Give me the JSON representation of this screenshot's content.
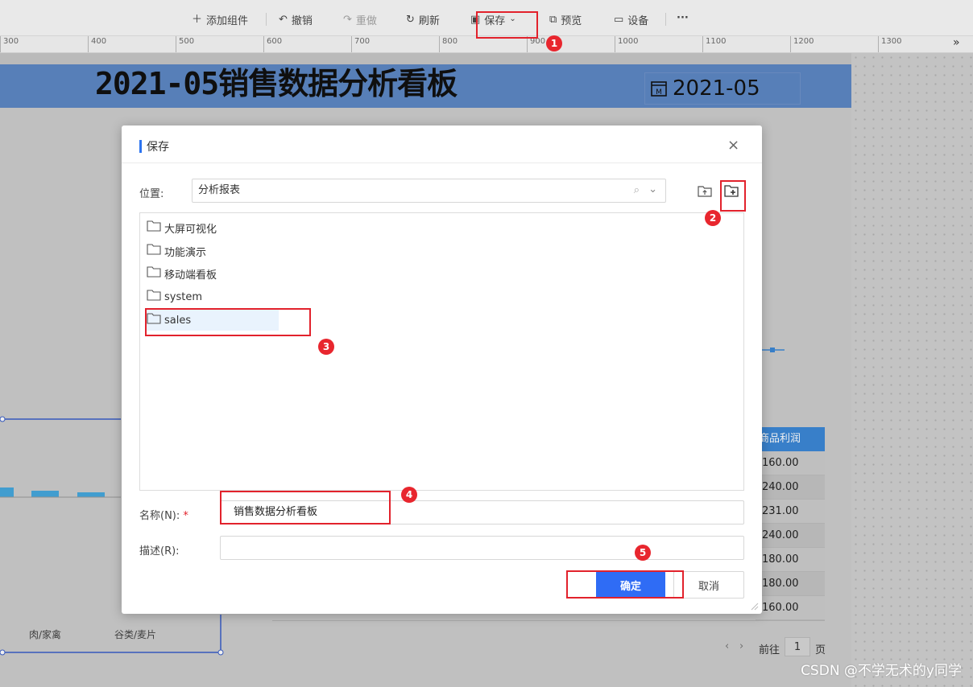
{
  "toolbar": {
    "add_component": "添加组件",
    "undo": "撤销",
    "redo": "重做",
    "refresh": "刷新",
    "save": "保存",
    "preview": "预览",
    "device": "设备",
    "more": "···"
  },
  "ruler": {
    "ticks": [
      "300",
      "400",
      "500",
      "600",
      "700",
      "800",
      "900",
      "1000",
      "1100",
      "1200",
      "1300"
    ],
    "expand": "»"
  },
  "dashboard": {
    "title": "2021-05销售数据分析看板",
    "date_value": "2021-05",
    "calendar_icon_letter": "M",
    "table_header": "商品利润",
    "table_values": [
      "160.00",
      "240.00",
      "231.00",
      "240.00",
      "180.00",
      "180.00",
      "160.00"
    ],
    "axis_categories": [
      "肉/家禽",
      "谷类/麦片"
    ],
    "pager_prefix": "前往",
    "pager_page": "1",
    "pager_suffix": "页"
  },
  "dialog": {
    "title": "保存",
    "location_label": "位置:",
    "location_value": "分析报表",
    "folders": [
      "大屏可视化",
      "功能演示",
      "移动端看板",
      "system",
      "sales"
    ],
    "selected_folder": "sales",
    "name_label": "名称(N):",
    "required_mark": "*",
    "name_value": "销售数据分析看板",
    "desc_label": "描述(R):",
    "desc_value": "",
    "ok": "确定",
    "cancel": "取消"
  },
  "annotations": [
    "1",
    "2",
    "3",
    "4",
    "5"
  ],
  "colors": {
    "accent": "#2f6cf5",
    "highlight": "#e2222c",
    "header_band": "#5d87c4",
    "table_header": "#3c87d6"
  },
  "watermark": "CSDN @不学无术的y同学"
}
